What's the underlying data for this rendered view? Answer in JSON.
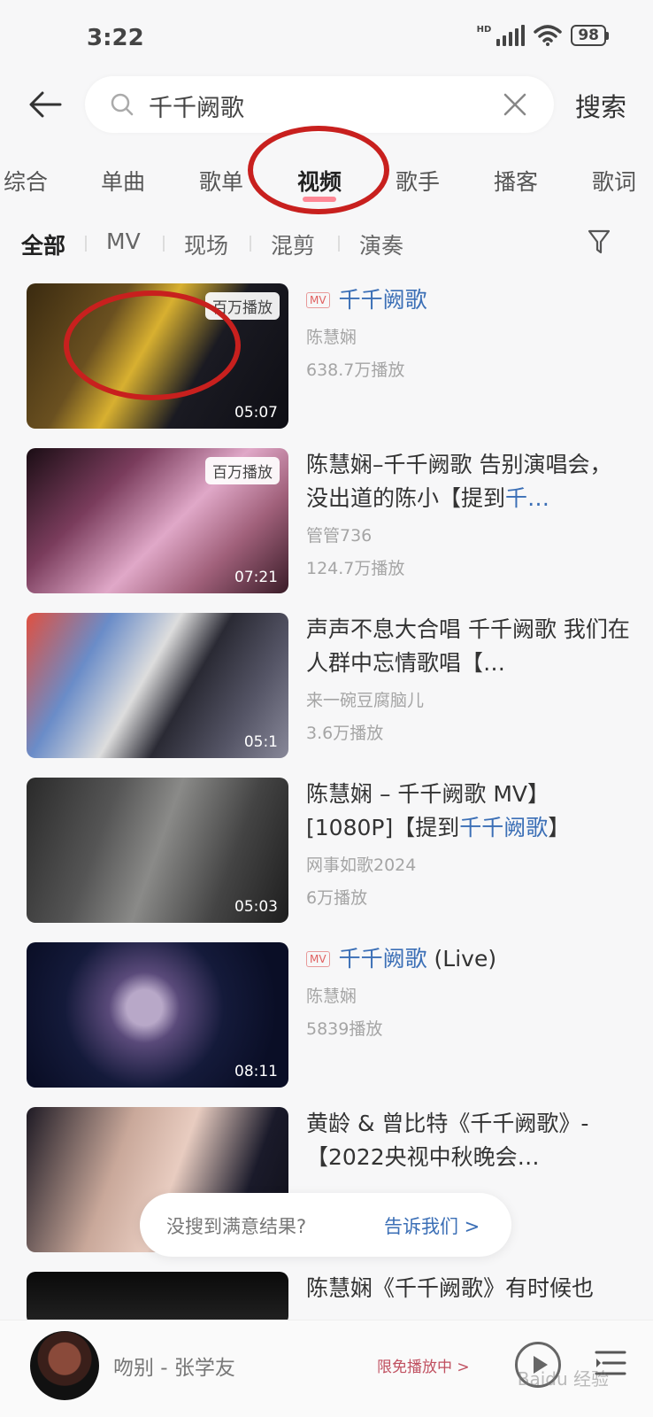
{
  "status": {
    "time": "3:22",
    "network": "HD",
    "battery": "98"
  },
  "search": {
    "query": "千千阙歌",
    "button": "搜索"
  },
  "tabs": [
    {
      "label": "综合"
    },
    {
      "label": "单曲"
    },
    {
      "label": "歌单"
    },
    {
      "label": "视频"
    },
    {
      "label": "歌手"
    },
    {
      "label": "播客"
    },
    {
      "label": "歌词"
    }
  ],
  "subtabs": [
    {
      "label": "全部"
    },
    {
      "label": "MV"
    },
    {
      "label": "现场"
    },
    {
      "label": "混剪"
    },
    {
      "label": "演奏"
    }
  ],
  "videos": [
    {
      "tag": "MV",
      "title_plain": "",
      "title_hl": "千千阙歌",
      "title_tail": "",
      "badge": "百万播放",
      "duration": "05:07",
      "author": "陈慧娴",
      "plays": "638.7万播放"
    },
    {
      "title_plain": "陈慧娴–千千阙歌 告别演唱会，没出道的陈小【提到",
      "title_hl": "千…",
      "badge": "百万播放",
      "duration": "07:21",
      "author": "管管736",
      "plays": "124.7万播放"
    },
    {
      "title_plain": "声声不息大合唱 千千阙歌 我们在人群中忘情歌唱【…",
      "title_hl": "",
      "duration": "05:1",
      "author": "来一碗豆腐脑儿",
      "plays": "3.6万播放"
    },
    {
      "title_plain": "陈慧娴 – 千千阙歌 MV】[1080P]【提到",
      "title_hl": "千千阙歌",
      "title_tail": "】",
      "duration": "05:03",
      "author": "网事如歌2024",
      "plays": "6万播放"
    },
    {
      "tag": "MV",
      "title_hl": "千千阙歌",
      "title_tail": " (Live)",
      "duration": "08:11",
      "author": "陈慧娴",
      "plays": "5839播放"
    },
    {
      "title_plain": "黄龄 & 曾比特《千千阙歌》-【2022央视中秋晚会…",
      "title_hl": ""
    },
    {
      "title_plain": "陈慧娴《千千阙歌》有时候也"
    }
  ],
  "feedback": {
    "question": "没搜到满意结果?",
    "link": "告诉我们 >"
  },
  "player": {
    "title": "吻别 - 张学友",
    "tag": "限免播放中 >"
  },
  "watermark": "Baidu 经验"
}
